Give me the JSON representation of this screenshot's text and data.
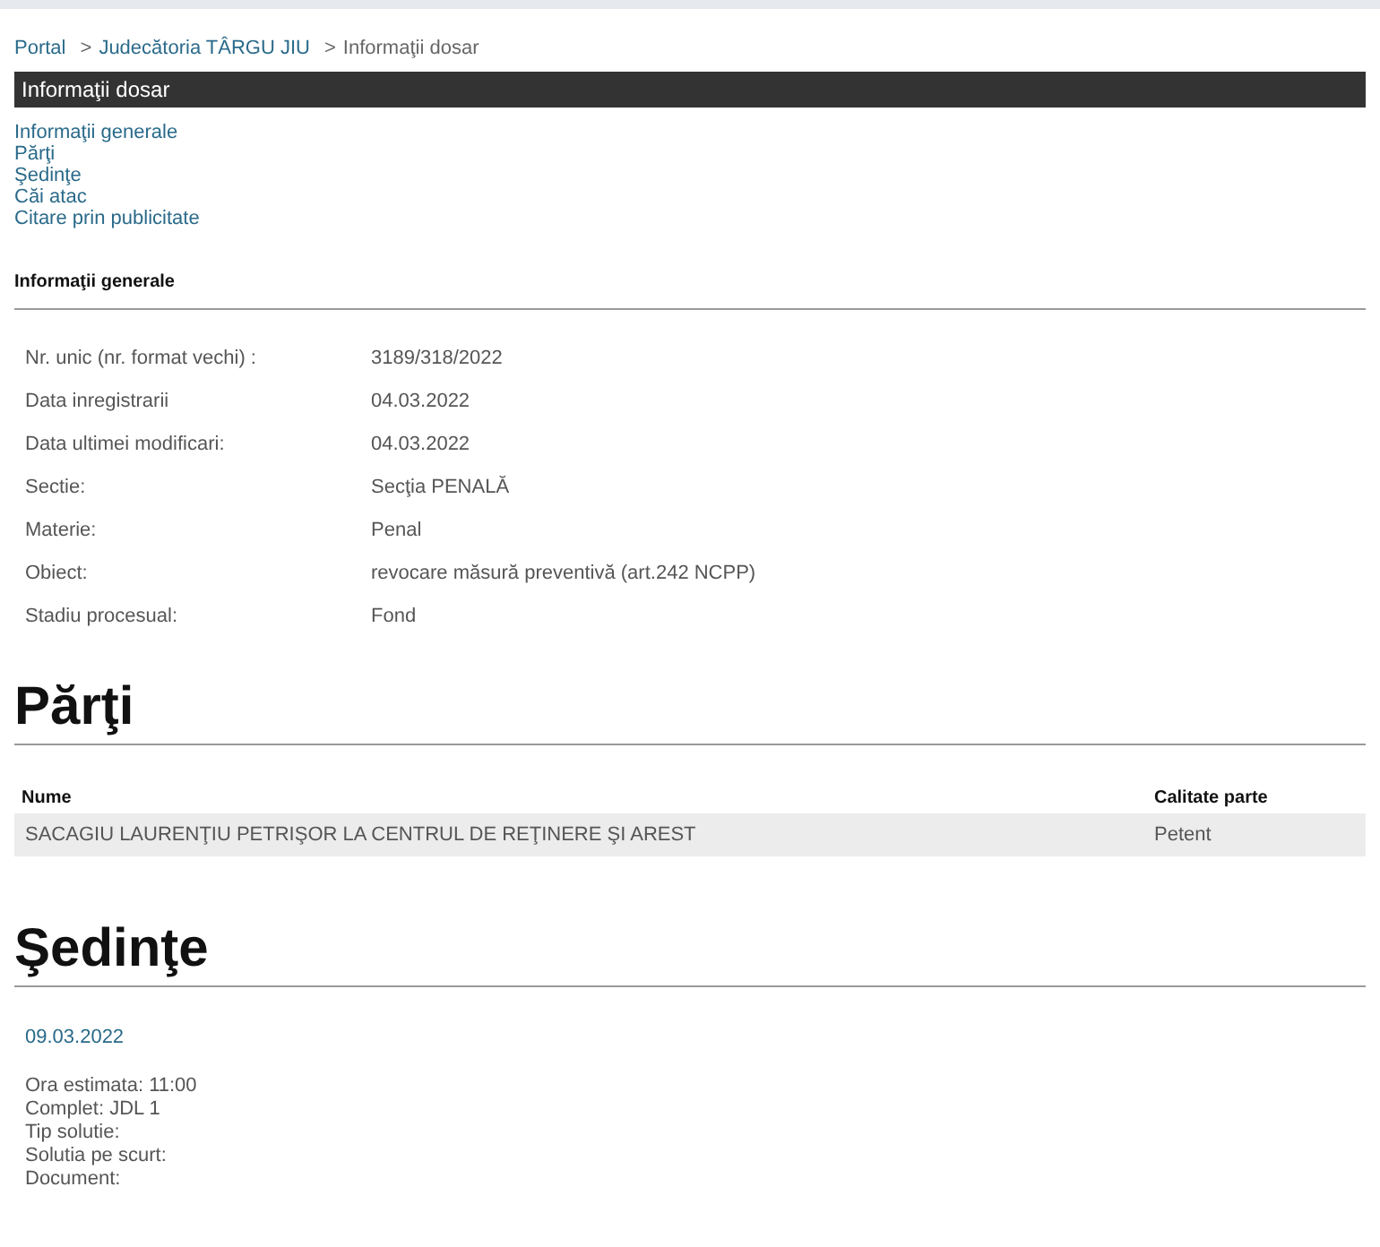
{
  "breadcrumb": [
    {
      "label": "Portal",
      "link": true
    },
    {
      "separator": ">",
      "label": "Judecătoria TÂRGU JIU",
      "link": true
    },
    {
      "separator": ">",
      "label": "Informaţii dosar",
      "link": false
    }
  ],
  "header_bar": {
    "title": "Informaţii dosar"
  },
  "nav_links": [
    "Informaţii generale",
    "Părţi",
    "Şedinţe",
    "Căi atac",
    "Citare prin publicitate"
  ],
  "general_info": {
    "title": "Informaţii generale",
    "rows": [
      {
        "label": "Nr. unic (nr. format vechi) :",
        "value": "3189/318/2022"
      },
      {
        "label": "Data inregistrarii",
        "value": "04.03.2022"
      },
      {
        "label": "Data ultimei modificari:",
        "value": "04.03.2022"
      },
      {
        "label": "Sectie:",
        "value": "Secţia PENALĂ"
      },
      {
        "label": "Materie:",
        "value": "Penal"
      },
      {
        "label": "Obiect:",
        "value": "revocare măsură preventivă (art.242 NCPP)"
      },
      {
        "label": "Stadiu procesual:",
        "value": "Fond"
      }
    ]
  },
  "parti": {
    "title": "Părţi",
    "columns": [
      "Nume",
      "Calitate parte"
    ],
    "rows": [
      [
        "SACAGIU LAURENŢIU PETRIŞOR LA CENTRUL DE REŢINERE ŞI AREST",
        "Petent"
      ]
    ]
  },
  "sedinte": {
    "title": "Şedinţe",
    "items": [
      {
        "date": "09.03.2022",
        "details": [
          "Ora estimata: 11:00",
          "Complet: JDL 1",
          "Tip solutie:",
          "Solutia pe scurt:",
          "Document:"
        ]
      }
    ]
  }
}
